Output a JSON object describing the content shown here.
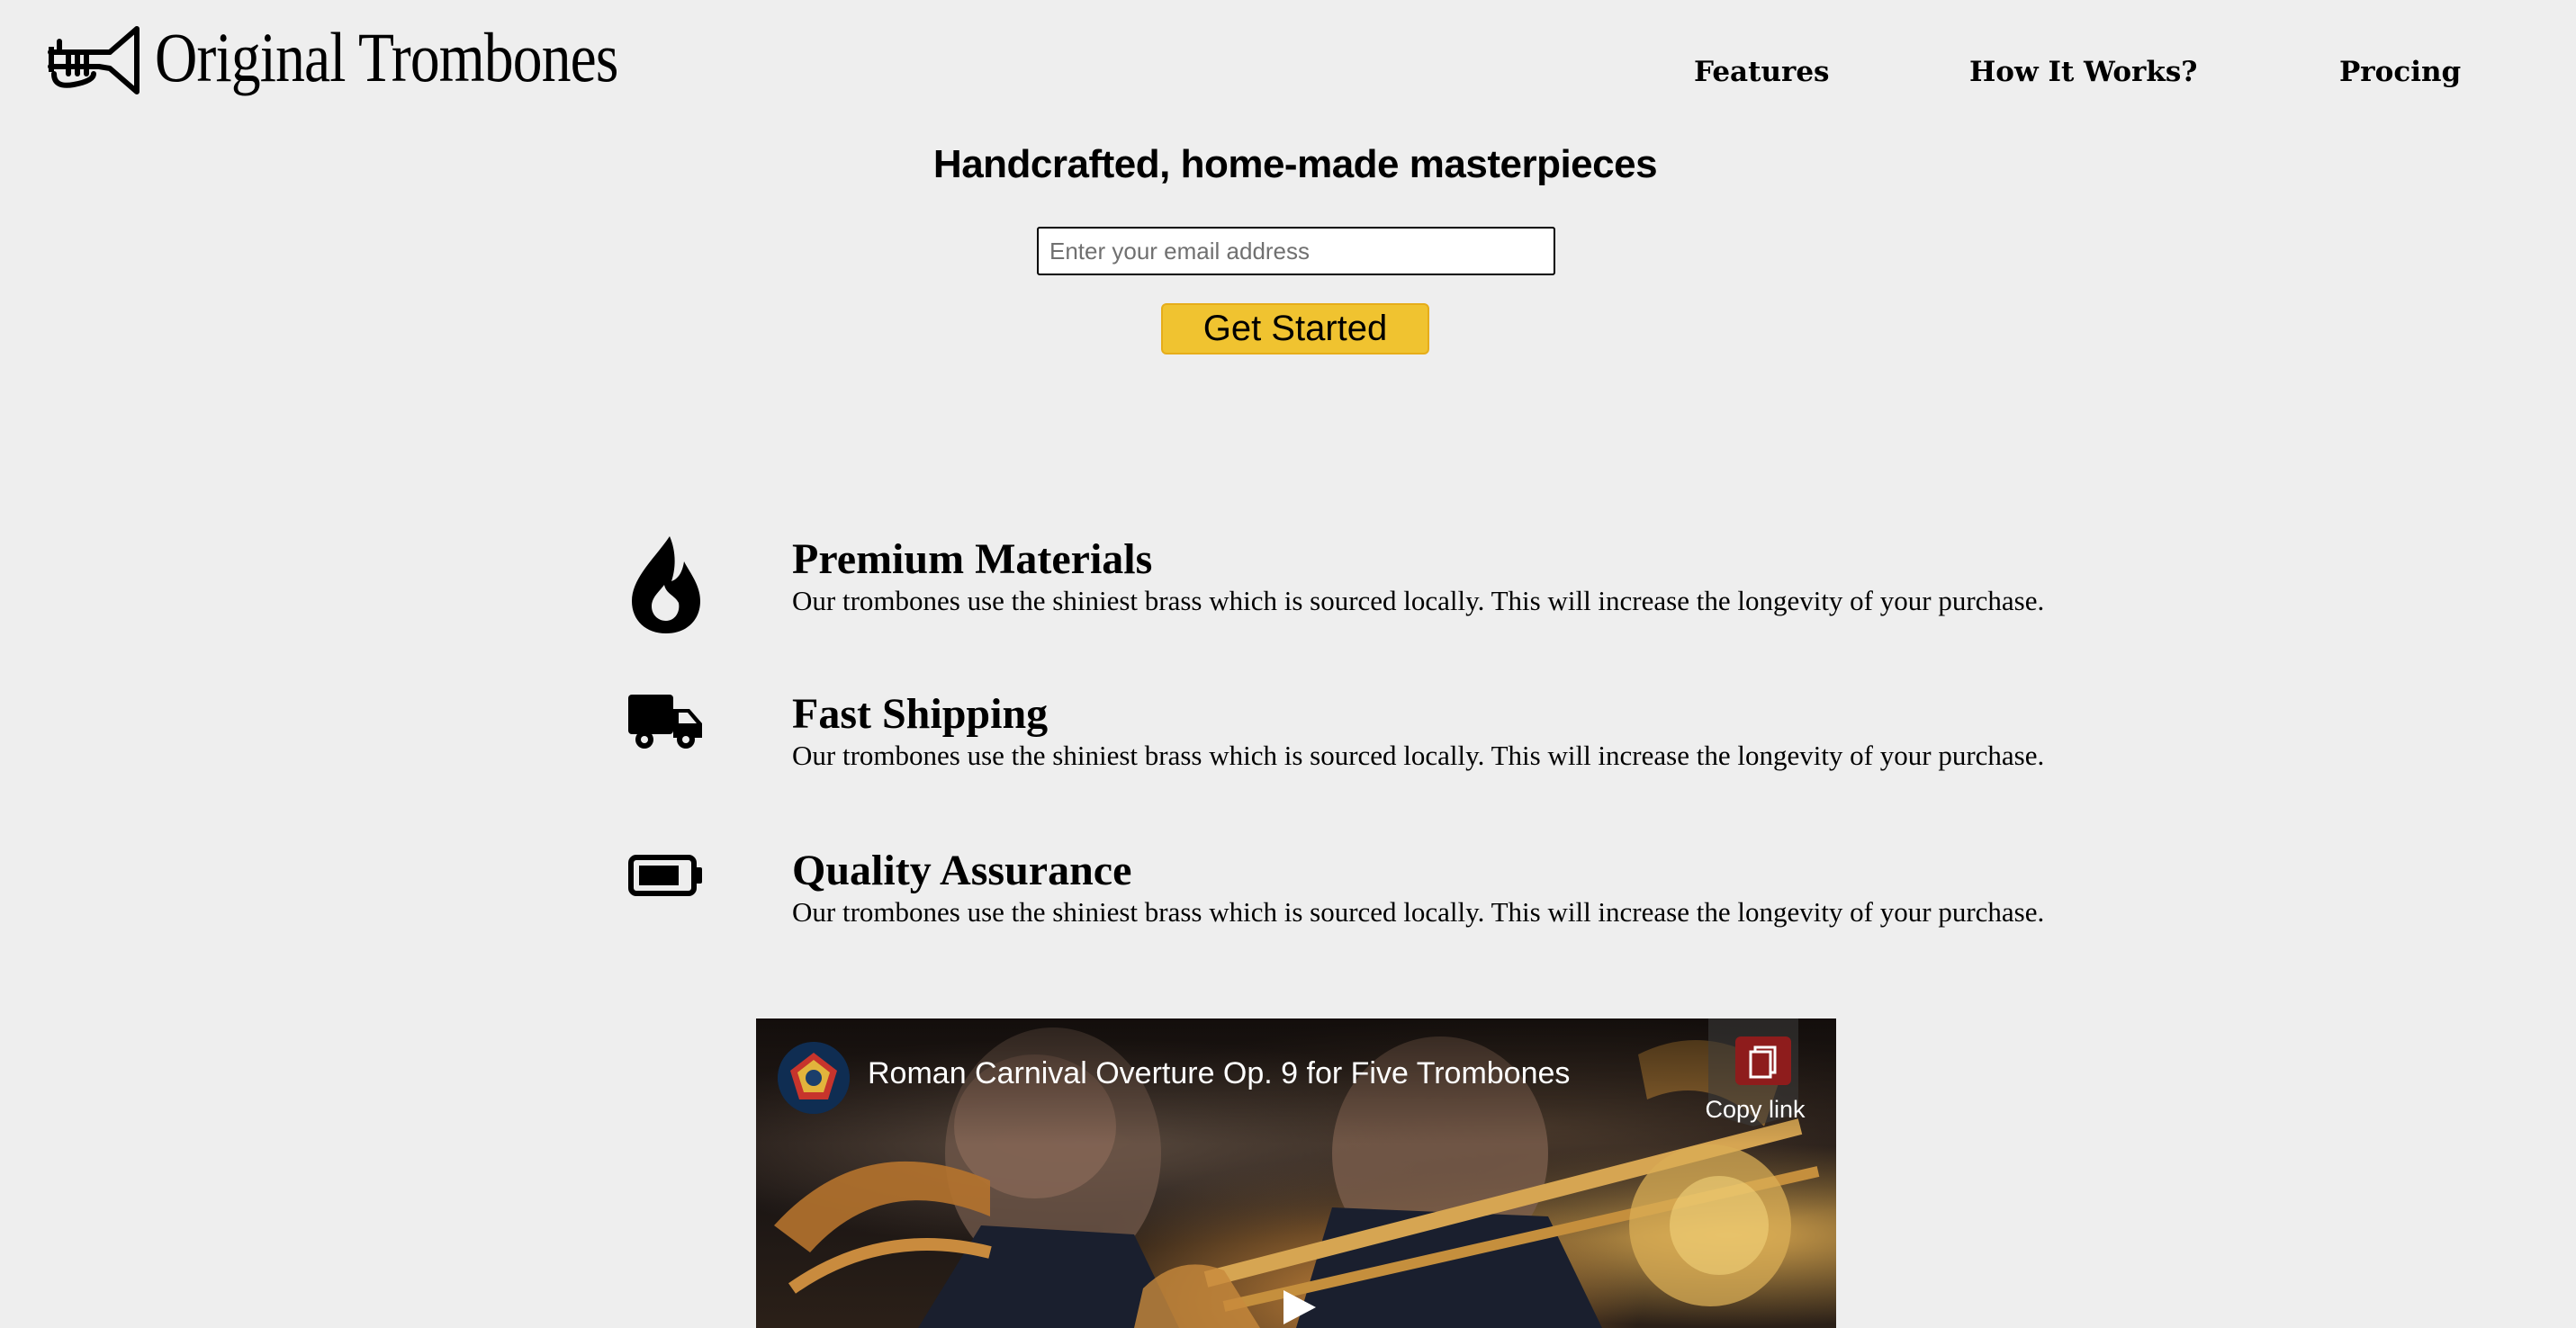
{
  "header": {
    "logo_text": "Original Trombones",
    "nav": [
      {
        "label": "Features"
      },
      {
        "label": "How It Works?"
      },
      {
        "label": "Procing"
      }
    ]
  },
  "hero": {
    "title": "Handcrafted, home-made masterpieces",
    "email_placeholder": "Enter your email address",
    "cta_label": "Get Started",
    "cta_color": "#f0c330"
  },
  "features": [
    {
      "icon": "fire-icon",
      "title": "Premium Materials",
      "text": "Our trombones use the shiniest brass which is sourced locally. This will increase the longevity of your purchase."
    },
    {
      "icon": "truck-icon",
      "title": "Fast Shipping",
      "text": "Our trombones use the shiniest brass which is sourced locally. This will increase the longevity of your purchase."
    },
    {
      "icon": "battery-icon",
      "title": "Quality Assurance",
      "text": "Our trombones use the shiniest brass which is sourced locally. This will increase the longevity of your purchase."
    }
  ],
  "video": {
    "title": "Roman Carnival Overture Op. 9 for Five Trombones",
    "copy_link_label": "Copy link",
    "copy_icon": "copy-icon",
    "play_icon": "play-icon"
  }
}
